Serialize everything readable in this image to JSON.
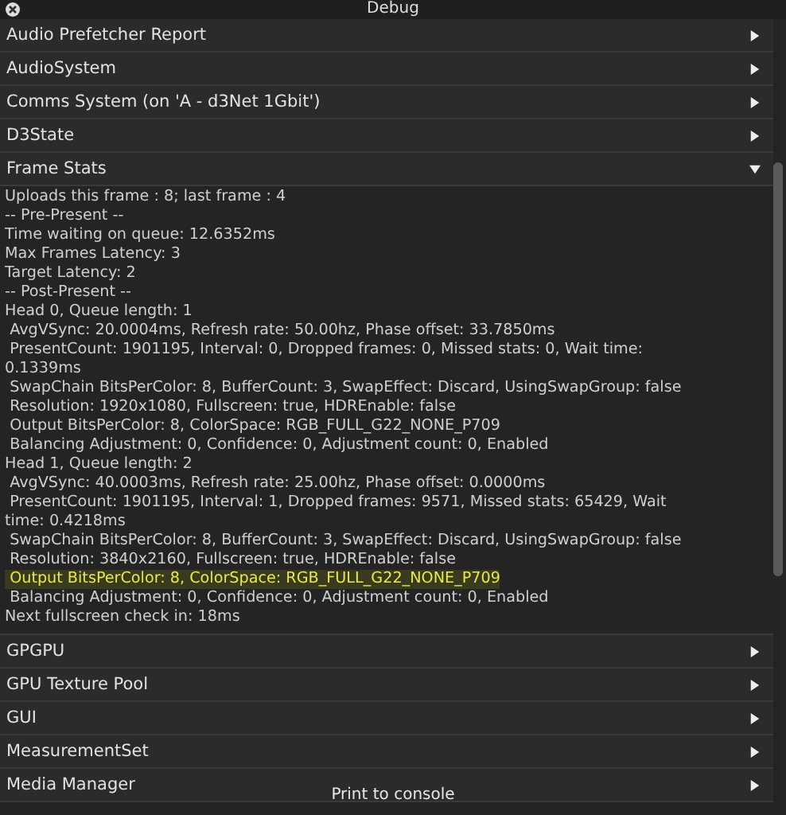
{
  "window": {
    "title": "Debug"
  },
  "sections": [
    {
      "title": "Audio Prefetcher Report",
      "expanded": false
    },
    {
      "title": "AudioSystem",
      "expanded": false
    },
    {
      "title": "Comms System (on 'A - d3Net 1Gbit')",
      "expanded": false
    },
    {
      "title": "D3State",
      "expanded": false
    },
    {
      "title": "Frame Stats",
      "expanded": true,
      "lines": [
        {
          "text": "Uploads this frame : 8; last frame : 4",
          "highlighted": false
        },
        {
          "text": "-- Pre-Present --",
          "highlighted": false
        },
        {
          "text": "Time waiting on queue: 12.6352ms",
          "highlighted": false
        },
        {
          "text": "Max Frames Latency: 3",
          "highlighted": false
        },
        {
          "text": "Target Latency: 2",
          "highlighted": false
        },
        {
          "text": "-- Post-Present --",
          "highlighted": false
        },
        {
          "text": "Head 0, Queue length: 1",
          "highlighted": false
        },
        {
          "text": " AvgVSync: 20.0004ms, Refresh rate: 50.00hz, Phase offset: 33.7850ms",
          "highlighted": false
        },
        {
          "text": " PresentCount: 1901195, Interval: 0, Dropped frames: 0, Missed stats: 0, Wait time: 0.1339ms",
          "highlighted": false
        },
        {
          "text": " SwapChain BitsPerColor: 8, BufferCount: 3, SwapEffect: Discard, UsingSwapGroup: false",
          "highlighted": false
        },
        {
          "text": " Resolution: 1920x1080, Fullscreen: true, HDREnable: false",
          "highlighted": false
        },
        {
          "text": " Output BitsPerColor: 8, ColorSpace: RGB_FULL_G22_NONE_P709",
          "highlighted": false
        },
        {
          "text": " Balancing Adjustment: 0, Confidence: 0, Adjustment count: 0, Enabled",
          "highlighted": false
        },
        {
          "text": "Head 1, Queue length: 2",
          "highlighted": false
        },
        {
          "text": " AvgVSync: 40.0003ms, Refresh rate: 25.00hz, Phase offset: 0.0000ms",
          "highlighted": false
        },
        {
          "text": " PresentCount: 1901195, Interval: 1, Dropped frames: 9571, Missed stats: 65429, Wait time: 0.4218ms",
          "highlighted": false
        },
        {
          "text": " SwapChain BitsPerColor: 8, BufferCount: 3, SwapEffect: Discard, UsingSwapGroup: false",
          "highlighted": false
        },
        {
          "text": " Resolution: 3840x2160, Fullscreen: true, HDREnable: false",
          "highlighted": false
        },
        {
          "text": " Output BitsPerColor: 8, ColorSpace: RGB_FULL_G22_NONE_P709",
          "highlighted": true
        },
        {
          "text": " Balancing Adjustment: 0, Confidence: 0, Adjustment count: 0, Enabled",
          "highlighted": false
        },
        {
          "text": "Next fullscreen check in: 18ms",
          "highlighted": false
        }
      ]
    },
    {
      "title": "GPGPU",
      "expanded": false
    },
    {
      "title": "GPU Texture Pool",
      "expanded": false
    },
    {
      "title": "GUI",
      "expanded": false
    },
    {
      "title": "MeasurementSet",
      "expanded": false
    },
    {
      "title": "Media Manager",
      "expanded": false
    }
  ],
  "footer": {
    "button": "Print to console"
  }
}
